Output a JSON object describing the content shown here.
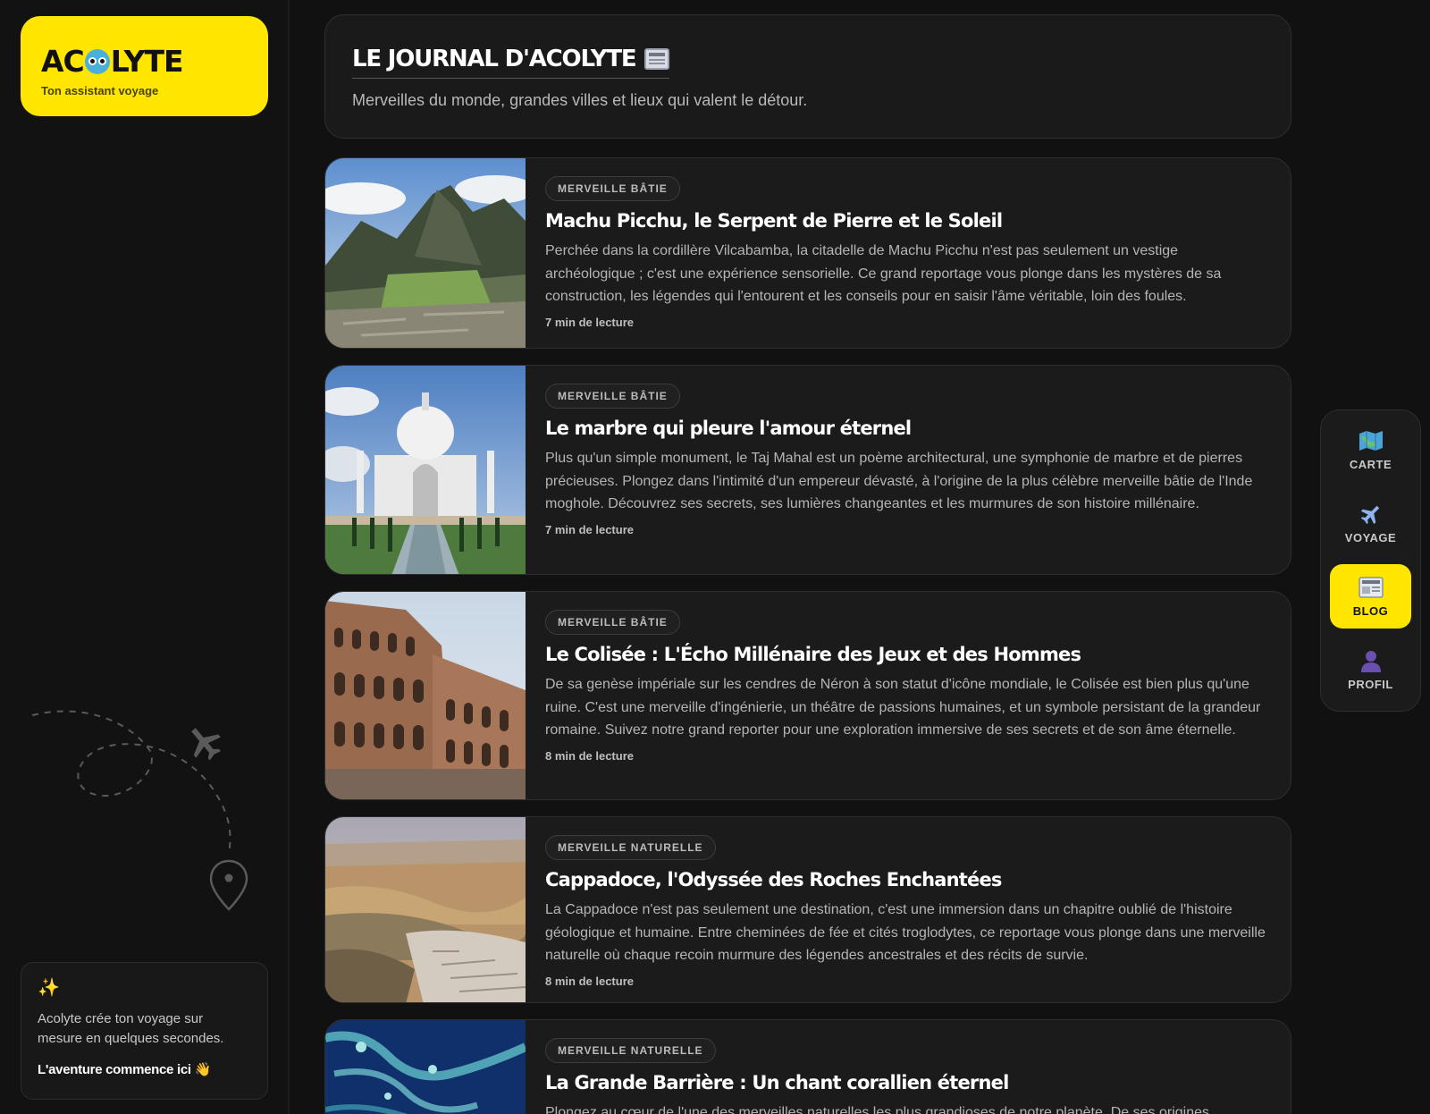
{
  "brand": {
    "name_start": "AC",
    "name_end": "LYTE",
    "tagline": "Ton assistant voyage"
  },
  "header": {
    "title": "LE JOURNAL D'ACOLYTE",
    "subtitle": "Merveilles du monde, grandes villes et lieux qui valent le détour."
  },
  "articles": [
    {
      "badge": "MERVEILLE BÂTIE",
      "title": "Machu Picchu, le Serpent de Pierre et le Soleil",
      "excerpt": "Perchée dans la cordillère Vilcabamba, la citadelle de Machu Picchu n'est pas seulement un vestige archéologique ; c'est une expérience sensorielle. Ce grand reportage vous plonge dans les mystères de sa construction, les légendes qui l'entourent et les conseils pour en saisir l'âme véritable, loin des foules.",
      "read_time": "7 min de lecture"
    },
    {
      "badge": "MERVEILLE BÂTIE",
      "title": "Le marbre qui pleure l'amour éternel",
      "excerpt": "Plus qu'un simple monument, le Taj Mahal est un poème architectural, une symphonie de marbre et de pierres précieuses. Plongez dans l'intimité d'un empereur dévasté, à l'origine de la plus célèbre merveille bâtie de l'Inde moghole. Découvrez ses secrets, ses lumières changeantes et les murmures de son histoire millénaire.",
      "read_time": "7 min de lecture"
    },
    {
      "badge": "MERVEILLE BÂTIE",
      "title": "Le Colisée : L'Écho Millénaire des Jeux et des Hommes",
      "excerpt": "De sa genèse impériale sur les cendres de Néron à son statut d'icône mondiale, le Colisée est bien plus qu'une ruine. C'est une merveille d'ingénierie, un théâtre de passions humaines, et un symbole persistant de la grandeur romaine. Suivez notre grand reporter pour une exploration immersive de ses secrets et de son âme éternelle.",
      "read_time": "8 min de lecture"
    },
    {
      "badge": "MERVEILLE NATURELLE",
      "title": "Cappadoce, l'Odyssée des Roches Enchantées",
      "excerpt": "La Cappadoce n'est pas seulement une destination, c'est une immersion dans un chapitre oublié de l'histoire géologique et humaine. Entre cheminées de fée et cités troglodytes, ce reportage vous plonge dans une merveille naturelle où chaque recoin murmure des légendes ancestrales et des récits de survie.",
      "read_time": "8 min de lecture"
    },
    {
      "badge": "MERVEILLE NATURELLE",
      "title": "La Grande Barrière : Un chant corallien éternel",
      "excerpt": "Plongez au cœur de l'une des merveilles naturelles les plus grandioses de notre planète. De ses origines",
      "read_time": ""
    }
  ],
  "promo": {
    "text": "Acolyte crée ton voyage sur mesure en quelques secondes.",
    "cta": "L'aventure commence ici 👋"
  },
  "nav": {
    "items": [
      {
        "label": "CARTE",
        "icon": "map-icon"
      },
      {
        "label": "VOYAGE",
        "icon": "airplane-icon"
      },
      {
        "label": "BLOG",
        "icon": "newspaper-icon",
        "active": true
      },
      {
        "label": "PROFIL",
        "icon": "person-icon"
      }
    ]
  },
  "colors": {
    "accent": "#ffe600",
    "background": "#111111",
    "card": "#1b1b1b"
  }
}
